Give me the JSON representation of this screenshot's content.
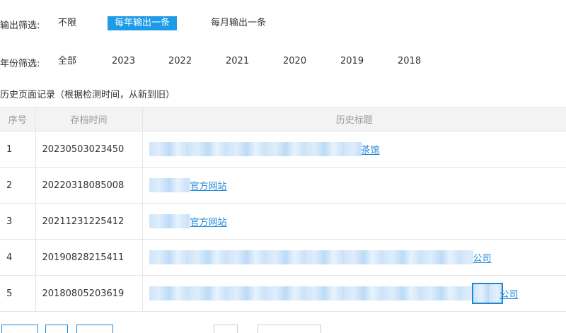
{
  "output_filter": {
    "label": "输出筛选:",
    "options": [
      "不限",
      "每年输出一条",
      "每月输出一条"
    ],
    "selected": "每年输出一条"
  },
  "year_filter": {
    "label": "年份筛选:",
    "options": [
      "全部",
      "2023",
      "2022",
      "2021",
      "2020",
      "2019",
      "2018"
    ]
  },
  "section_title": "历史页面记录（根据检测时间，从新到旧）",
  "table": {
    "headers": [
      "序号",
      "存档时间",
      "历史标题"
    ],
    "rows": [
      {
        "index": "1",
        "time": "20230503023450",
        "title_suffix": "茶馆"
      },
      {
        "index": "2",
        "time": "20220318085008",
        "title_suffix": "官方网站"
      },
      {
        "index": "3",
        "time": "20211231225412",
        "title_suffix": "官方网站"
      },
      {
        "index": "4",
        "time": "20190828215411",
        "title_suffix": "公司"
      },
      {
        "index": "5",
        "time": "20180805203619",
        "title_suffix": "公司"
      }
    ]
  },
  "colors": {
    "accent": "#1e9be8",
    "link": "#1e88d8"
  }
}
